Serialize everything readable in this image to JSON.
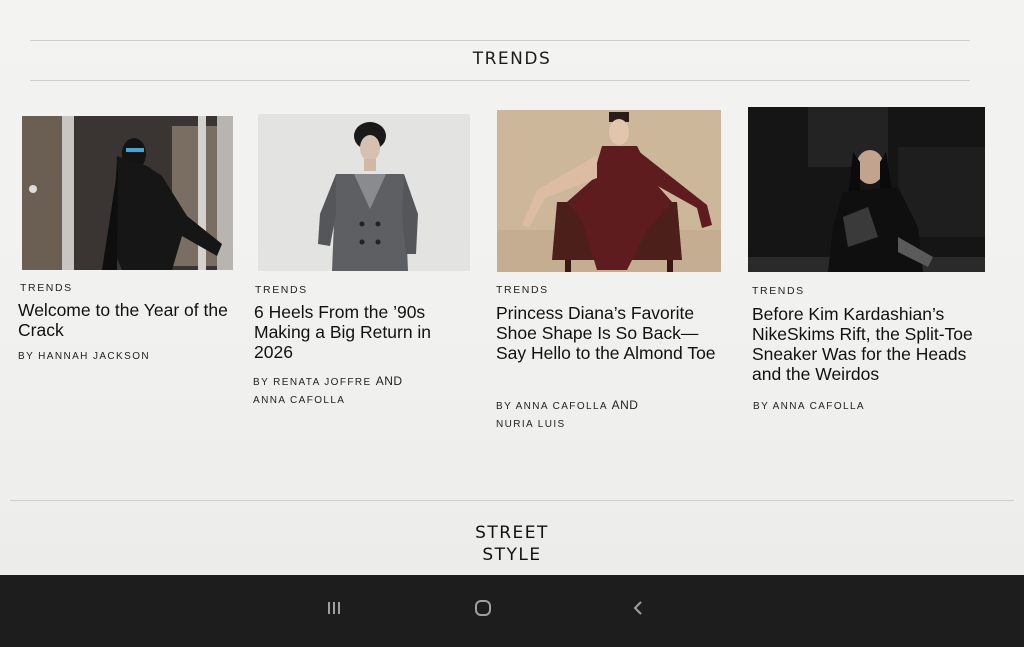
{
  "section": {
    "title": "TRENDS"
  },
  "articles": [
    {
      "category": "TRENDS",
      "headline": "Welcome to the Year of the Crack",
      "byline_prefix": "BY",
      "authors": [
        "HANNAH JACKSON"
      ],
      "image": "woman-leather-jacket-photo"
    },
    {
      "category": "TRENDS",
      "headline": "6 Heels From the ’90s Making a Big Return in 2026",
      "byline_prefix": "BY",
      "authors": [
        "RENATA JOFFRE",
        "ANNA CAFOLLA"
      ],
      "conjunction": "AND",
      "image": "woman-grey-coat-photo"
    },
    {
      "category": "TRENDS",
      "headline": "Princess Diana’s Favorite Shoe Shape Is So Back—Say Hello to the Almond Toe",
      "byline_prefix": "BY",
      "authors": [
        "ANNA CAFOLLA",
        "NURIA LUIS"
      ],
      "conjunction": "AND",
      "image": "model-burgundy-dress-photo"
    },
    {
      "category": "TRENDS",
      "headline": "Before Kim Kardashian’s NikeSkims Rift, the Split-Toe Sneaker Was for the Heads and the Weirdos",
      "byline_prefix": "BY",
      "authors": [
        "ANNA CAFOLLA"
      ],
      "image": "woman-dark-night-photo"
    }
  ],
  "next_section": {
    "title_line1": "STREET",
    "title_line2": "STYLE"
  },
  "system_nav": {
    "recents_icon": "recents-icon",
    "home_icon": "home-icon",
    "back_icon": "back-icon"
  }
}
